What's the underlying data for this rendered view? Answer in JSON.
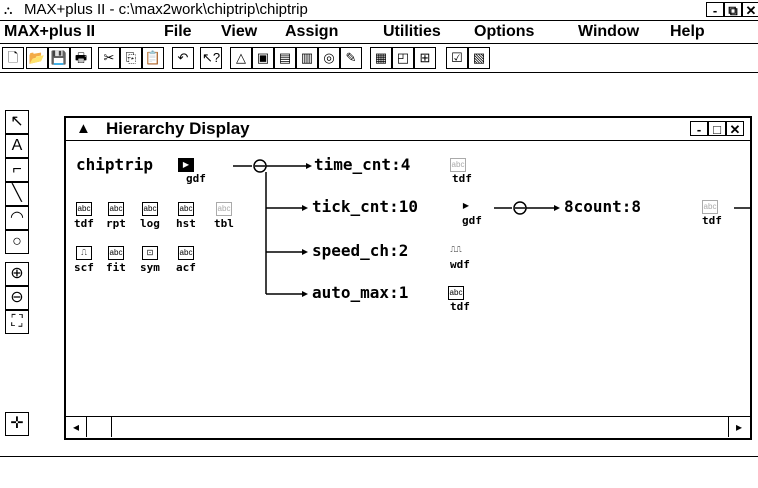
{
  "window": {
    "title": "MAX+plus II - c:\\max2work\\chiptrip\\chiptrip"
  },
  "menu": {
    "items": [
      "MAX+plus II",
      "File",
      "View",
      "Assign",
      "Utilities",
      "Options",
      "Window",
      "Help"
    ]
  },
  "hierarchy": {
    "title": "Hierarchy Display",
    "root": {
      "name": "chiptrip",
      "type": "gdf"
    },
    "root_files": {
      "row1": [
        "tdf",
        "rpt",
        "log",
        "hst",
        "tbl"
      ],
      "row2": [
        "scf",
        "fit",
        "sym",
        "acf"
      ]
    },
    "children": [
      {
        "label": "time_cnt:4",
        "type": "tdf"
      },
      {
        "label": "tick_cnt:10",
        "type": "gdf"
      },
      {
        "label": "speed_ch:2",
        "type": "wdf"
      },
      {
        "label": "auto_max:1",
        "type": "tdf"
      }
    ],
    "grandchild": {
      "label": "8count:8",
      "type": "tdf"
    }
  },
  "icons": {
    "collapse": "collapse-node-icon",
    "file": "file-icon"
  }
}
